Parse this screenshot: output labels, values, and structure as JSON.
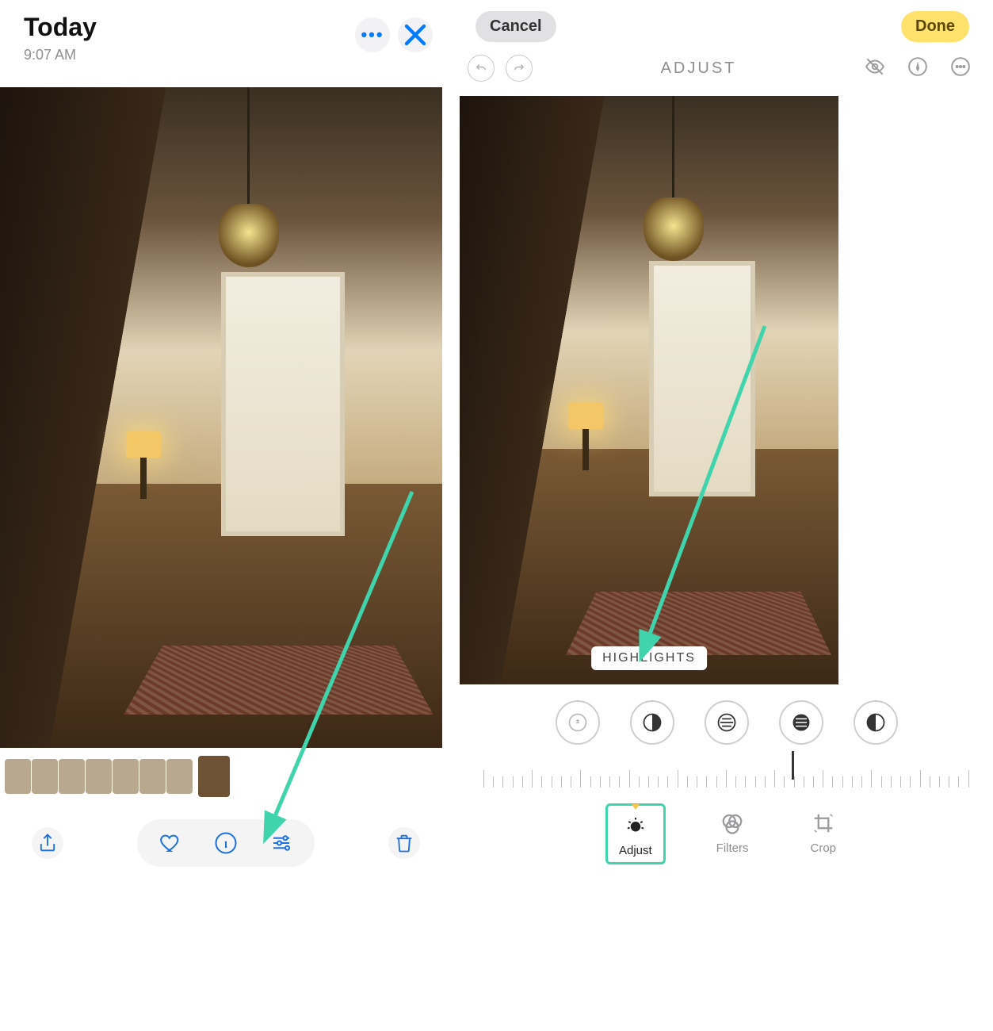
{
  "left": {
    "title": "Today",
    "time": "9:07 AM",
    "more_icon": "ellipsis-icon",
    "close_icon": "close-icon",
    "toolbar": {
      "share": "share-icon",
      "heart": "heart-icon",
      "info": "info-icon",
      "edit": "sliders-icon",
      "trash": "trash-icon"
    },
    "thumb_count": 7
  },
  "right": {
    "cancel": "Cancel",
    "done": "Done",
    "mode_label": "ADJUST",
    "undo_icon": "undo-icon",
    "redo_icon": "redo-icon",
    "hide_icon": "eye-off-icon",
    "markup_icon": "markup-icon",
    "more_icon": "ellipsis-circle-icon",
    "badge": "HIGHLIGHTS",
    "dials": [
      "auto",
      "exposure",
      "brilliance",
      "highlights",
      "shadows"
    ],
    "tabs": {
      "adjust": "Adjust",
      "filters": "Filters",
      "crop": "Crop"
    },
    "active_tab": "adjust"
  },
  "annotation": {
    "arrow_color": "#3fd4ab"
  }
}
